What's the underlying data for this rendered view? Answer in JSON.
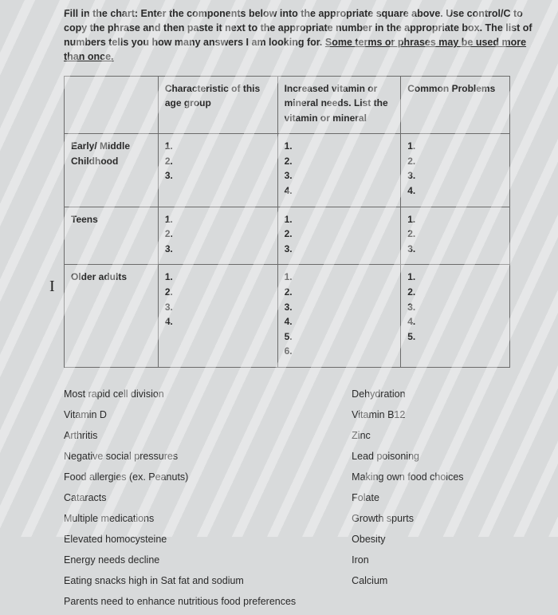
{
  "instructions": {
    "line1": "Fill in the chart: Enter the components below into the appropriate square above. Use control/C to",
    "line2": "copy the phrase and then paste it next to the appropriate number in the appropriate box. The list of",
    "line3": "numbers tells you how many answers I am looking for.",
    "underlined": "Some terms or phrases may be used more than once."
  },
  "table": {
    "headers": {
      "empty": "",
      "characteristic": "Characteristic of this age group",
      "needs": "Increased vitamin or mineral needs. List the vitamin or mineral",
      "problems": "Common Problems"
    },
    "rows": [
      {
        "label": "Early/ Middle Childhood",
        "characteristic": [
          "1.",
          "2.",
          "3."
        ],
        "needs": [
          "1.",
          "2.",
          "3.",
          "4."
        ],
        "problems": [
          "1.",
          "2.",
          "3.",
          "4."
        ]
      },
      {
        "label": "Teens",
        "characteristic": [
          "1.",
          "2.",
          "3."
        ],
        "needs": [
          "1.",
          "2.",
          "3."
        ],
        "problems": [
          "1.",
          "2.",
          "3."
        ]
      },
      {
        "label": "Older adults",
        "characteristic": [
          "1.",
          "2.",
          "3.",
          "4."
        ],
        "needs": [
          "1.",
          "2.",
          "3.",
          "4.",
          "5.",
          "6."
        ],
        "problems": [
          "1.",
          "2.",
          "3.",
          "4.",
          "5."
        ]
      }
    ]
  },
  "terms": {
    "left": [
      "Most rapid cell division",
      "Vitamin D",
      "Arthritis",
      "Negative social pressures",
      "Food allergies (ex. Peanuts)",
      "Cataracts",
      "Multiple medications",
      "Elevated homocysteine",
      "Energy needs decline",
      "Eating snacks high in Sat fat and sodium",
      "Parents need to enhance nutritious food preferences"
    ],
    "right": [
      "Dehydration",
      "Vitamin B12",
      "Zinc",
      "Lead poisoning",
      "Making own food choices",
      "Folate",
      "Growth spurts",
      "Obesity",
      "Iron",
      "Calcium"
    ]
  },
  "cursor_glyph": "I"
}
